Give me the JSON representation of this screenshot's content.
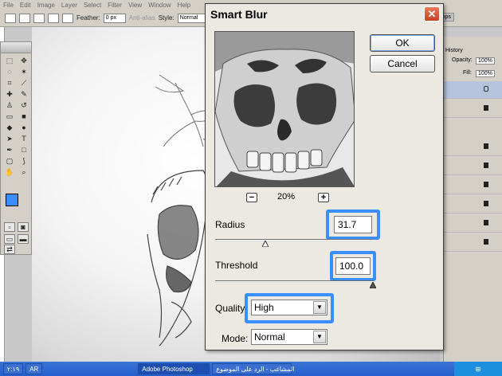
{
  "menubar": {
    "items": [
      "File",
      "Edit",
      "Image",
      "Layer",
      "Select",
      "Filter",
      "View",
      "Window",
      "Help"
    ]
  },
  "options": {
    "feather_label": "Feather:",
    "feather_value": "0 px",
    "antialias_label": "Anti-alias",
    "style_label": "Style:",
    "style_value": "Normal",
    "layer_comps": "Layer Comps"
  },
  "right_panel": {
    "history_tab": "History",
    "opacity_label": "Opacity:",
    "opacity_value": "100%",
    "fill_label": "Fill:",
    "fill_value": "100%"
  },
  "dialog": {
    "title": "Smart Blur",
    "ok_label": "OK",
    "cancel_label": "Cancel",
    "zoom_level": "20%",
    "radius_label": "Radius",
    "radius_value": "31.7",
    "radius_fraction": 0.317,
    "threshold_label": "Threshold",
    "threshold_value": "100.0",
    "threshold_fraction": 1.0,
    "quality_label": "Quality:",
    "quality_value": "High",
    "mode_label": "Mode:",
    "mode_value": "Normal"
  },
  "taskbar": {
    "start_label": "",
    "lang": "AR",
    "photoshop_item": "Adobe Photoshop",
    "browser_item": "المشاغب - الرد على الموضوع",
    "clock": "٢:١٩"
  },
  "colors": {
    "highlight": "#3a8eff",
    "foreground_swatch": "#3a8eff",
    "close_button": "#d9552f"
  }
}
